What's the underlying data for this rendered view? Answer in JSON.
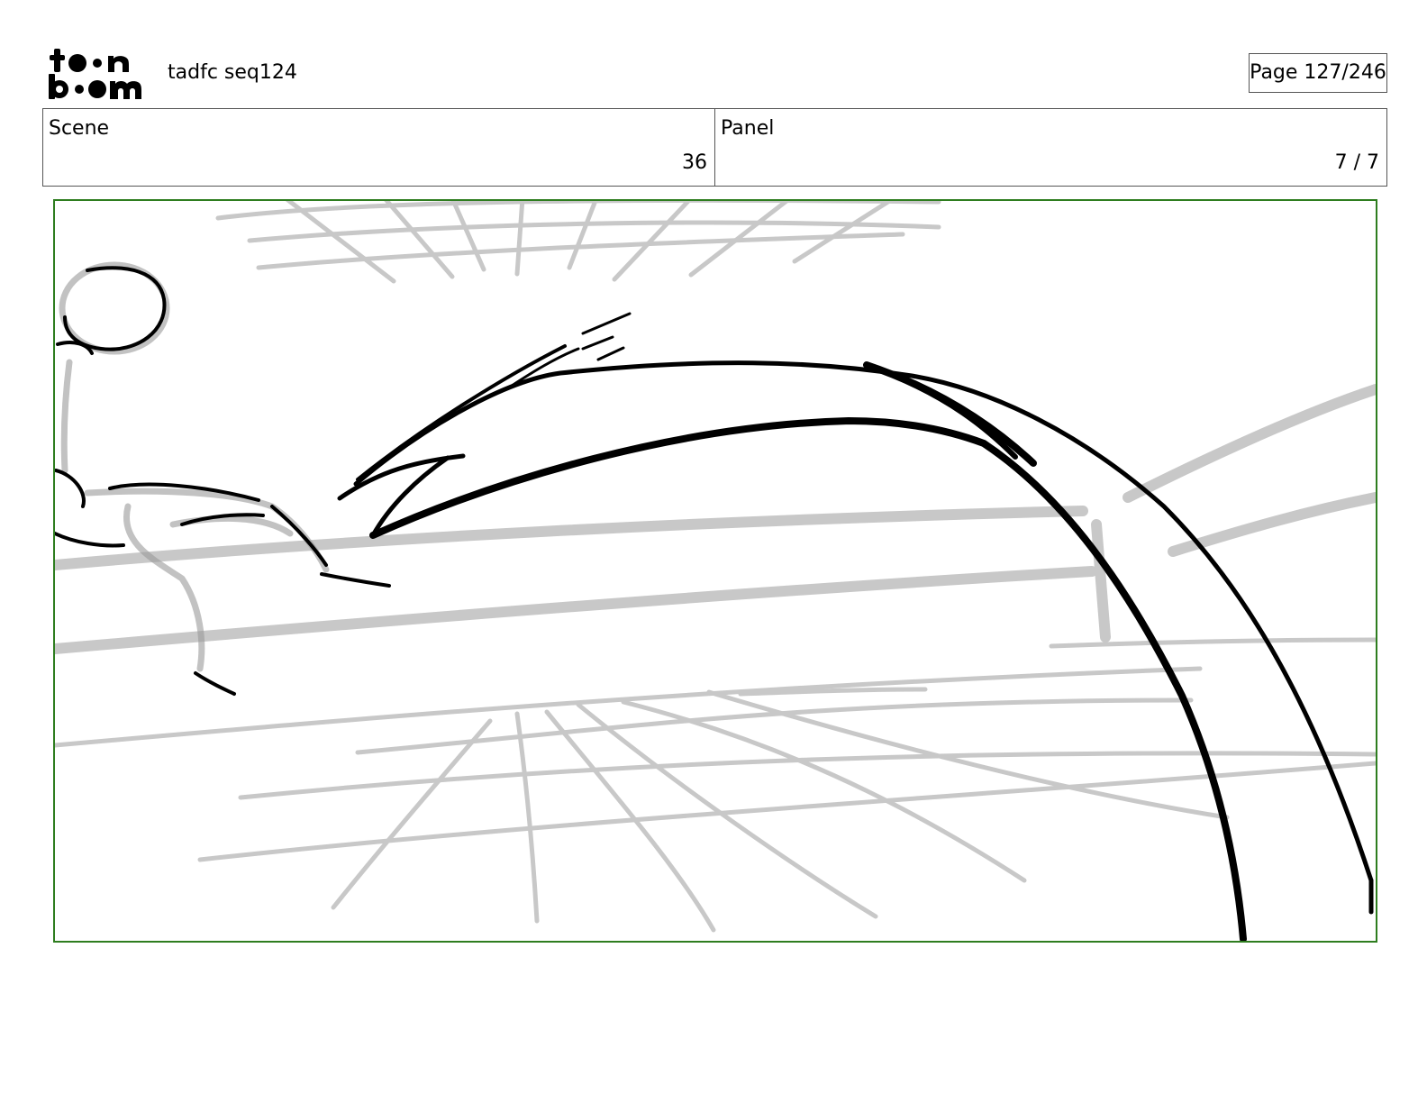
{
  "header": {
    "logo_text": "toon boom",
    "project_title": "tadfc seq124",
    "page_indicator": "Page 127/246"
  },
  "info": {
    "scene_label": "Scene",
    "scene_value": "36",
    "panel_label": "Panel",
    "panel_value": "7 / 7"
  },
  "colors": {
    "frame_border": "#2e7d1f",
    "sketch_light": "#c8c8c8",
    "sketch_dark": "#000000"
  }
}
